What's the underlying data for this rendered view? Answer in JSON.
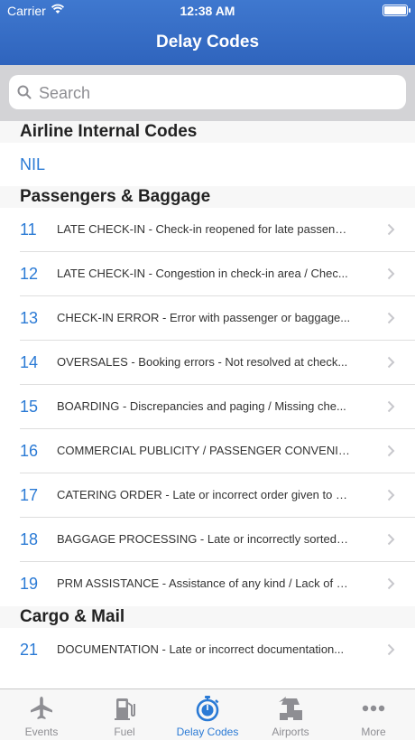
{
  "status_bar": {
    "carrier": "Carrier",
    "time": "12:38 AM"
  },
  "nav": {
    "title": "Delay Codes"
  },
  "search": {
    "placeholder": "Search"
  },
  "sections": [
    {
      "header": "Airline Internal Codes"
    },
    {
      "header": "Passengers & Baggage"
    },
    {
      "header": "Cargo & Mail"
    }
  ],
  "internal_row": {
    "code": "NIL"
  },
  "rows": [
    {
      "code": "11",
      "desc": "LATE CHECK-IN - Check-in reopened for late passeng..."
    },
    {
      "code": "12",
      "desc": "LATE CHECK-IN - Congestion in check-in area / Chec..."
    },
    {
      "code": "13",
      "desc": "CHECK-IN ERROR - Error with passenger or baggage..."
    },
    {
      "code": "14",
      "desc": "OVERSALES - Booking errors - Not resolved at check..."
    },
    {
      "code": "15",
      "desc": "BOARDING - Discrepancies and paging / Missing che..."
    },
    {
      "code": "16",
      "desc": "COMMERCIAL PUBLICITY / PASSENGER CONVENIEN..."
    },
    {
      "code": "17",
      "desc": "CATERING ORDER - Late or incorrect order given to s..."
    },
    {
      "code": "18",
      "desc": "BAGGAGE PROCESSING - Late or incorrectly sorted b..."
    },
    {
      "code": "19",
      "desc": "PRM ASSISTANCE - Assistance of any kind / Lack of s..."
    },
    {
      "code": "21",
      "desc": "DOCUMENTATION - Late or incorrect documentation..."
    }
  ],
  "tabs": [
    {
      "label": "Events",
      "icon": "airplane-icon"
    },
    {
      "label": "Fuel",
      "icon": "fuel-pump-icon"
    },
    {
      "label": "Delay Codes",
      "icon": "stopwatch-icon",
      "active": true
    },
    {
      "label": "Airports",
      "icon": "control-tower-icon"
    },
    {
      "label": "More",
      "icon": "more-dots-icon"
    }
  ],
  "colors": {
    "nav_bar": "#3570c8",
    "accent": "#2a7ad5",
    "tab_inactive": "#8e8e93"
  }
}
